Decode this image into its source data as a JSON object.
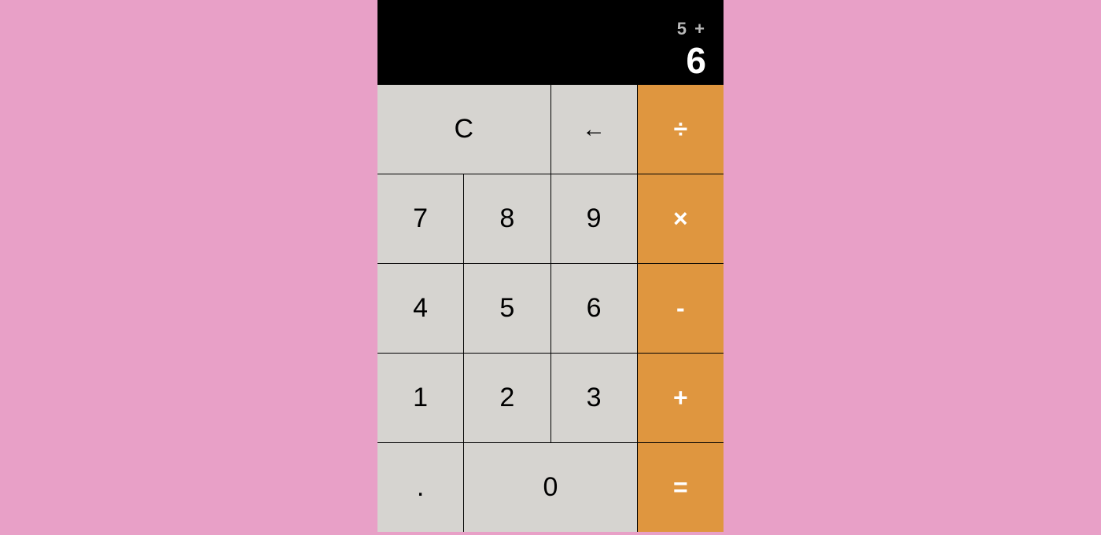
{
  "display": {
    "expression": "5 +",
    "current": "6"
  },
  "keys": {
    "clear": "C",
    "backspace": "←",
    "divide": "÷",
    "multiply": "×",
    "subtract": "-",
    "add": "+",
    "equals": "=",
    "decimal": ".",
    "k0": "0",
    "k1": "1",
    "k2": "2",
    "k3": "3",
    "k4": "4",
    "k5": "5",
    "k6": "6",
    "k7": "7",
    "k8": "8",
    "k9": "9"
  }
}
